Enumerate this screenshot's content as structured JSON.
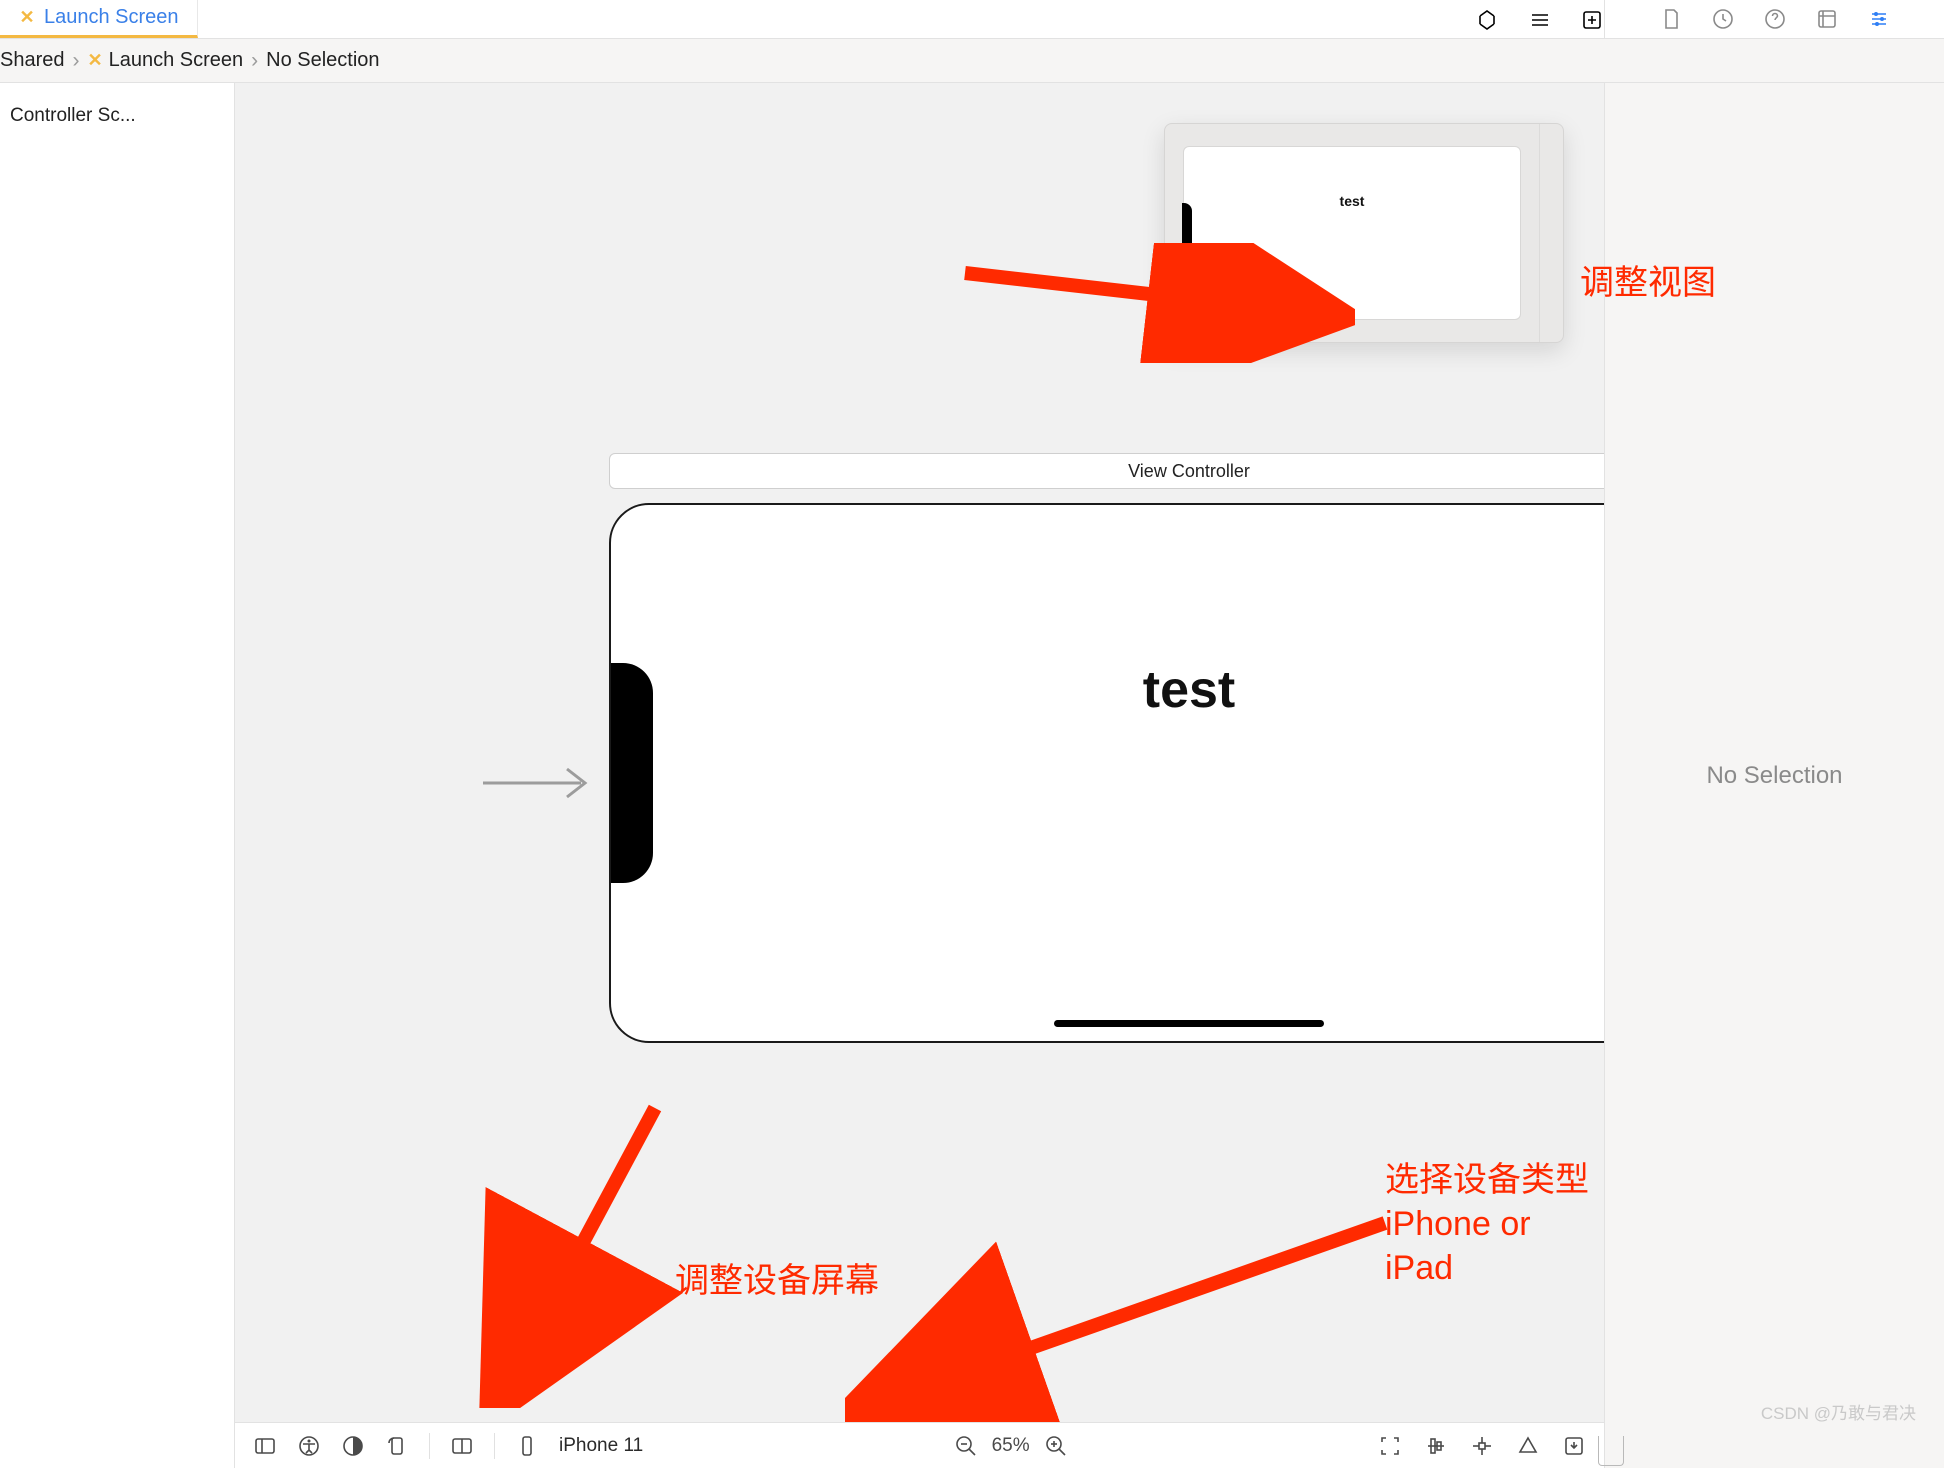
{
  "tab": {
    "label": "Launch Screen"
  },
  "breadcrumb": {
    "root": "Shared",
    "file": "Launch Screen",
    "selection": "No Selection"
  },
  "outline": {
    "item": "Controller Sc..."
  },
  "scene": {
    "title": "View Controller",
    "label_text": "test"
  },
  "minimap": {
    "label_text": "test"
  },
  "inspector": {
    "no_selection": "No Selection"
  },
  "bottom": {
    "device": "iPhone 11",
    "zoom": "65%"
  },
  "annotations": {
    "adjust_view": "调整视图",
    "adjust_device_screen": "调整设备屏幕",
    "select_device_type_l1": "选择设备类型",
    "select_device_type_l2": "iPhone or iPad"
  },
  "watermark": "CSDN @乃敢与君决"
}
